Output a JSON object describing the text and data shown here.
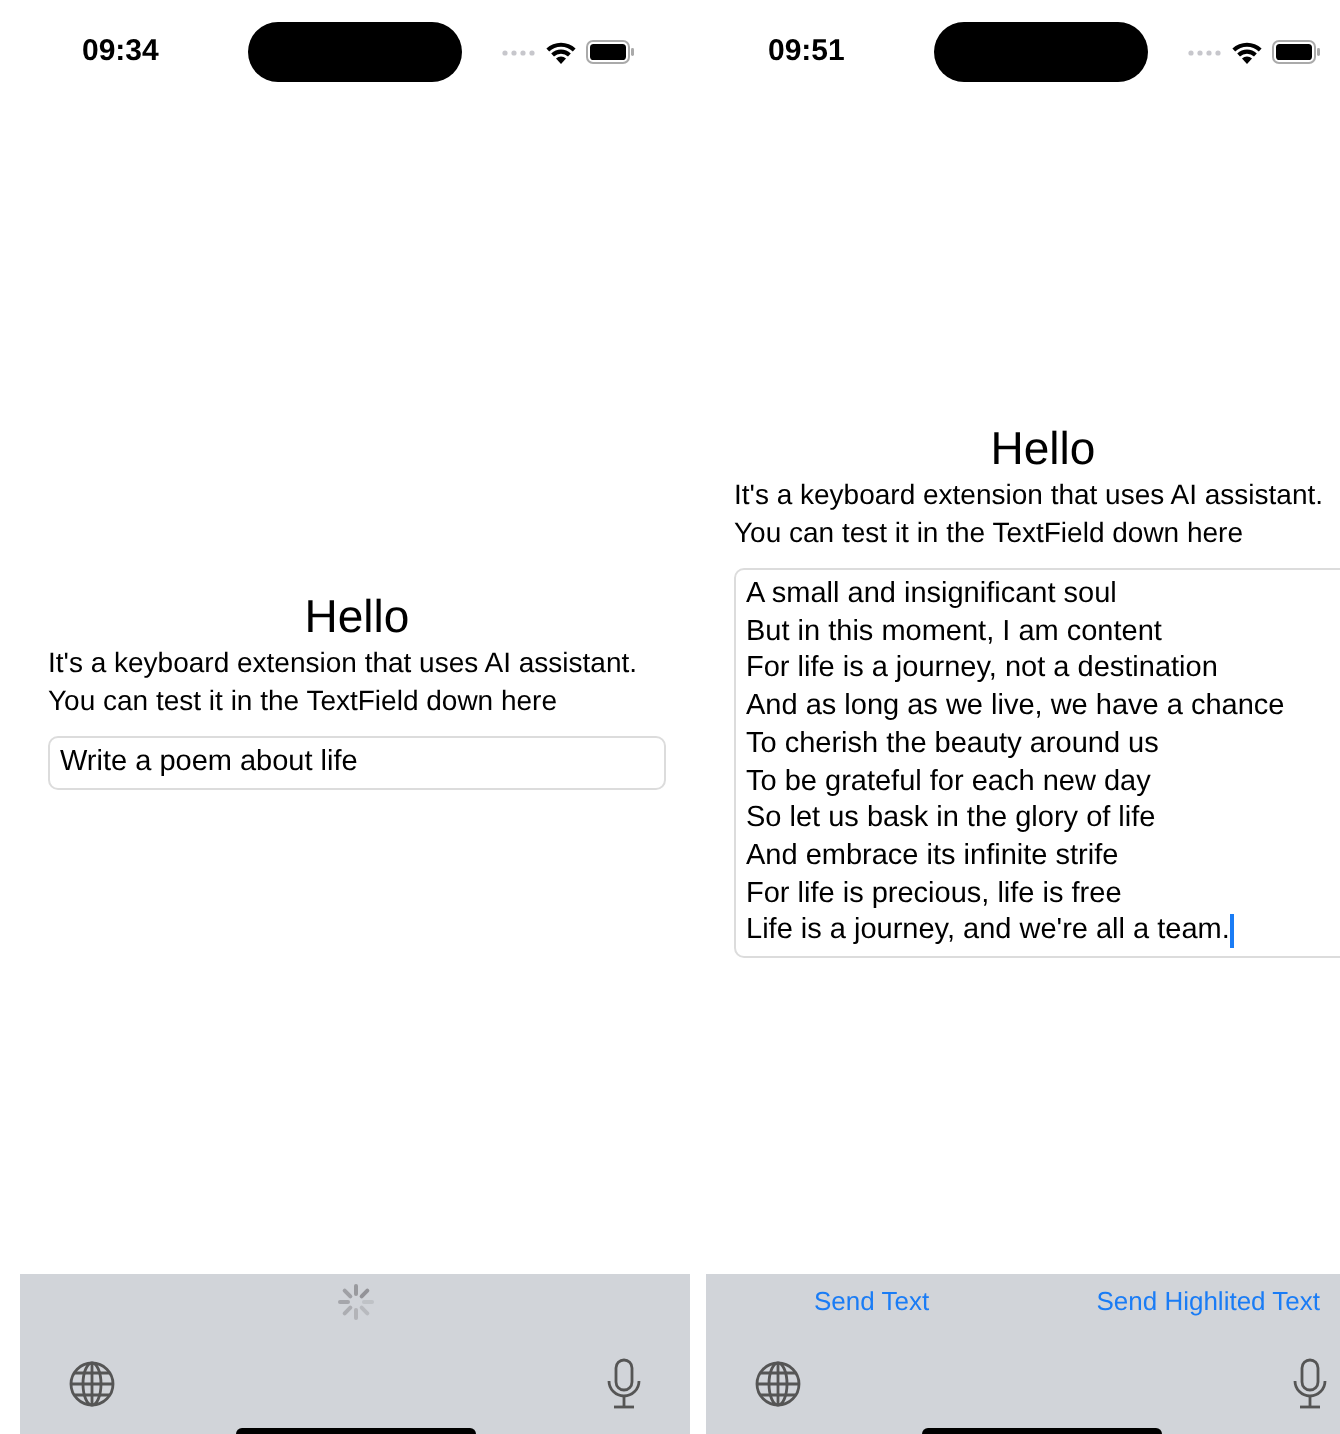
{
  "screens": [
    {
      "status_bar": {
        "time": "09:34"
      },
      "title": "Hello",
      "description": [
        "It's a keyboard extension that uses AI assistant.",
        "You can test it in the TextField down here"
      ],
      "field": {
        "value": [
          "Write a poem about life"
        ],
        "focused": false
      },
      "keyboard": {
        "loading": true
      }
    },
    {
      "status_bar": {
        "time": "09:51"
      },
      "title": "Hello",
      "description": [
        "It's a keyboard extension that uses AI assistant.",
        "You can test it in the TextField down here"
      ],
      "field": {
        "value": [
          "A small and insignificant soul",
          "But in this moment, I am content",
          "For life is a journey, not a destination",
          "And as long as we live, we have a chance",
          "To cherish the beauty around us",
          "To be grateful for each new day",
          "So let us bask in the glory of life",
          "And embrace its infinite strife",
          "For life is precious, life is free",
          "Life is a journey, and we're all a team."
        ],
        "focused": true
      },
      "keyboard": {
        "loading": false,
        "actions": [
          "Send Text",
          "Send Highlited Text"
        ]
      }
    }
  ]
}
